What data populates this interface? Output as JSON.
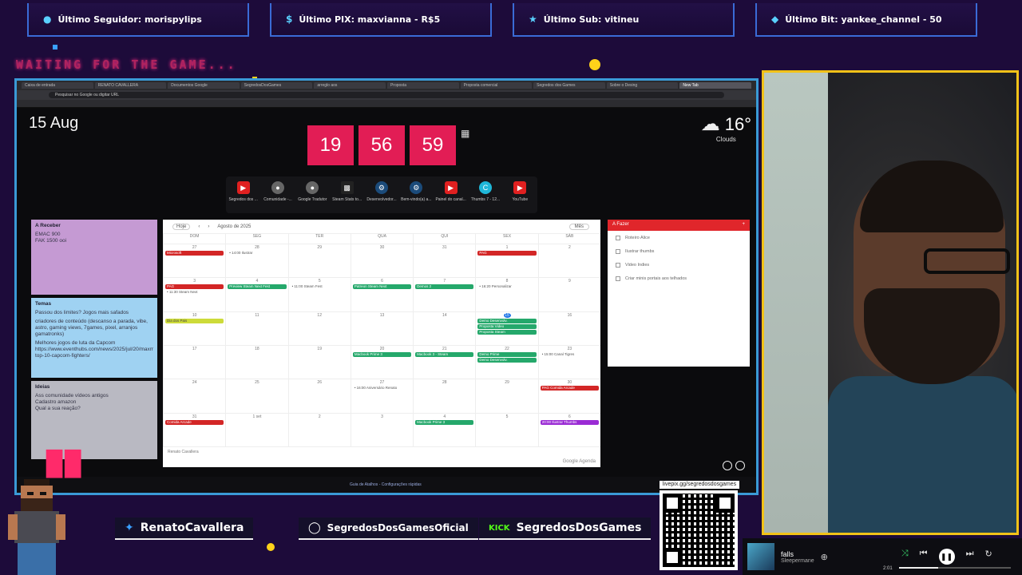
{
  "alerts": [
    {
      "icon": "user-icon",
      "label": "Último Seguidor: morispylips"
    },
    {
      "icon": "dollar-icon",
      "label": "Último PIX: maxvianna - R$5"
    },
    {
      "icon": "star-icon",
      "label": "Último Sub: vitineu"
    },
    {
      "icon": "diamond-icon",
      "label": "Último Bit: yankee_channel - 50"
    }
  ],
  "waiting_text": "WAITING FOR THE GAME...",
  "browser": {
    "tabs": [
      "Caixa de entrada",
      "RENATO CAVALLERA",
      "Documentos Google",
      "SegredosDosGames",
      "arreglo aos",
      "Proposta",
      "Proposta comercial",
      "Segredos dos Games",
      "Sobre o Desing",
      "New Tab"
    ],
    "address_placeholder": "Pesquisar no Google ou digitar URL"
  },
  "newtab": {
    "date": "15 Aug",
    "clock": {
      "h": "19",
      "m": "56",
      "s": "59"
    },
    "weather": {
      "temp": "16°",
      "condition": "Clouds"
    },
    "shortcuts": [
      {
        "icon": "youtube-icon",
        "color": "#e02020",
        "label": "Segredos dos ..."
      },
      {
        "icon": "globe-icon",
        "color": "#666",
        "label": "Comunidade -..."
      },
      {
        "icon": "globe-icon",
        "color": "#666",
        "label": "Google Tradutor"
      },
      {
        "icon": "stats-icon",
        "color": "#222",
        "label": "Steam Stats to..."
      },
      {
        "icon": "steam-icon",
        "color": "#1b4b7a",
        "label": "Desenvolvedor..."
      },
      {
        "icon": "steam-icon",
        "color": "#1b4b7a",
        "label": "Bem-vindo(a) a..."
      },
      {
        "icon": "youtube-icon",
        "color": "#e02020",
        "label": "Painel do canal..."
      },
      {
        "icon": "canva-icon",
        "color": "#1fb7d8",
        "label": "Thumbs 7 - 12..."
      },
      {
        "icon": "youtube-icon",
        "color": "#e02020",
        "label": "YouTube"
      }
    ]
  },
  "notes": {
    "pink": {
      "title": "A Receber",
      "lines": [
        "EMAC 900",
        "FAK 1500 ooi"
      ]
    },
    "blue": {
      "title": "Temas",
      "lines": [
        "Passou dos limites? Jogos mais safados",
        "criadores de conteúdo (descanso a parada, vibe, astro, gaming views, 7games, pixel, arranjos gamatronks)",
        "Melhores jogos de luta da Capcom https://www.eventhubs.com/news/2025/jul/20/maxmillen-top-10-capcom-fighters/"
      ]
    },
    "grey": {
      "title": "Ideias",
      "lines": [
        "Ass comunidade vídeos antigos",
        "Cadastro amazon",
        "Qual a sua reação?"
      ]
    }
  },
  "calendar": {
    "today_btn": "Hoje",
    "month": "Agosto de 2025",
    "view": "Mês",
    "weekdays": [
      "DOM",
      "SEG",
      "TER",
      "QUA",
      "QUI",
      "SEX",
      "SÁB"
    ],
    "weeks": [
      {
        "days": [
          "27",
          "28",
          "29",
          "30",
          "31",
          "1",
          "2"
        ],
        "events": [
          [
            {
              "c": "red",
              "t": "Microsoft"
            }
          ],
          [
            {
              "c": "txt",
              "t": "• 14:00 Ilustrar"
            }
          ],
          [],
          [],
          [],
          [
            {
              "c": "red",
              "t": "PAG"
            }
          ],
          []
        ]
      },
      {
        "days": [
          "3",
          "4",
          "5",
          "6",
          "7",
          "8",
          "9"
        ],
        "events": [
          [
            {
              "c": "red",
              "t": "PAG"
            },
            {
              "c": "txt",
              "t": "• 11:30 Steam Next"
            }
          ],
          [
            {
              "c": "green",
              "t": "Preview Steam Next Fest"
            }
          ],
          [
            {
              "c": "txt",
              "t": "• 11:00 Steam Fest"
            }
          ],
          [
            {
              "c": "green",
              "t": "Patreon Steam Next"
            }
          ],
          [
            {
              "c": "green",
              "t": "Demos 2"
            }
          ],
          [
            {
              "c": "txt",
              "t": "• 16:20 Personalizar"
            }
          ],
          []
        ]
      },
      {
        "days": [
          "10",
          "11",
          "12",
          "13",
          "14",
          "15",
          "16"
        ],
        "events": [
          [
            {
              "c": "yellow",
              "t": "Dia dos Pais"
            }
          ],
          [],
          [],
          [],
          [],
          [
            {
              "c": "green",
              "t": "Demo Desenvolv."
            },
            {
              "c": "green",
              "t": "Proposta Video"
            },
            {
              "c": "green",
              "t": "Proposta Steam"
            }
          ],
          []
        ]
      },
      {
        "days": [
          "17",
          "18",
          "19",
          "20",
          "21",
          "22",
          "23"
        ],
        "events": [
          [],
          [],
          [],
          [
            {
              "c": "green",
              "t": "Macbook Prime 3"
            }
          ],
          [
            {
              "c": "green",
              "t": "Macbook 3 - Steam"
            }
          ],
          [
            {
              "c": "green",
              "t": "Demo Prime"
            },
            {
              "c": "green",
              "t": "Demo Desenvolv."
            }
          ],
          [
            {
              "c": "txt",
              "t": "• 15:00 Canal Tigres"
            }
          ]
        ]
      },
      {
        "days": [
          "24",
          "25",
          "26",
          "27",
          "28",
          "29",
          "30"
        ],
        "events": [
          [],
          [],
          [],
          [
            {
              "c": "txt",
              "t": "• 16:00 Aniversário Renato"
            }
          ],
          [],
          [],
          [
            {
              "c": "red",
              "t": "PAG Comida Arcade"
            }
          ]
        ]
      },
      {
        "days": [
          "31",
          "1 set",
          "2",
          "3",
          "4",
          "5",
          "6"
        ],
        "events": [
          [
            {
              "c": "red",
              "t": "Comida Arcade"
            }
          ],
          [],
          [],
          [],
          [
            {
              "c": "green",
              "t": "Macbook Prime 3"
            }
          ],
          [],
          [
            {
              "c": "purple",
              "t": "20:00 Ilustrar Thumbs"
            }
          ]
        ]
      }
    ],
    "footer": "Renato Cavallera",
    "brand": "Google Agenda"
  },
  "todo": {
    "title": "A Fazer",
    "items": [
      "Roteiro Alice",
      "Ilustrar thumbs",
      "Video Indies",
      "Criar minis portais aos telhados"
    ]
  },
  "taskbar_link": "Guia de Atalhos - Configurações rápidas",
  "social": [
    {
      "icon": "twitter-icon",
      "label": "RenatoCavallera"
    },
    {
      "icon": "instagram-icon",
      "label": "SegredosDosGamesOficial"
    },
    {
      "icon": "kick-icon",
      "label": "SegredosDosGames"
    }
  ],
  "qr_label": "livepix.gg/segredosdosgames",
  "player": {
    "title": "falls",
    "artist": "Sleepermane",
    "time": "2:01",
    "progress": 0.35
  }
}
